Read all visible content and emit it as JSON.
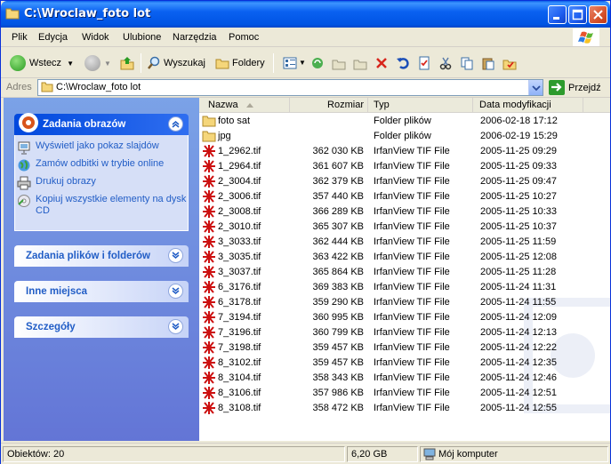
{
  "window": {
    "title": "C:\\Wroclaw_foto lot"
  },
  "menu": [
    "Plik",
    "Edycja",
    "Widok",
    "Ulubione",
    "Narzędzia",
    "Pomoc"
  ],
  "toolbar": {
    "back_label": "Wstecz",
    "search_label": "Wyszukaj",
    "folders_label": "Foldery"
  },
  "address": {
    "label": "Adres",
    "value": "C:\\Wroclaw_foto lot",
    "go_label": "Przejdź"
  },
  "taskpane": {
    "image_tasks": {
      "title": "Zadania obrazów",
      "items": [
        "Wyświetl jako pokaz slajdów",
        "Zamów odbitki w trybie online",
        "Drukuj obrazy",
        "Kopiuj wszystkie elementy na dysk CD"
      ]
    },
    "file_tasks": "Zadania plików i folderów",
    "other_places": "Inne miejsca",
    "details": "Szczegóły"
  },
  "columns": {
    "name": "Nazwa",
    "size": "Rozmiar",
    "type": "Typ",
    "date": "Data modyfikacji"
  },
  "files": [
    {
      "name": "foto sat",
      "size": "",
      "type": "Folder plików",
      "date": "2006-02-18 17:12",
      "kind": "folder"
    },
    {
      "name": "jpg",
      "size": "",
      "type": "Folder plików",
      "date": "2006-02-19 15:29",
      "kind": "folder"
    },
    {
      "name": "1_2962.tif",
      "size": "362 030 KB",
      "type": "IrfanView TIF File",
      "date": "2005-11-25 09:29",
      "kind": "tif"
    },
    {
      "name": "1_2964.tif",
      "size": "361 607 KB",
      "type": "IrfanView TIF File",
      "date": "2005-11-25 09:33",
      "kind": "tif"
    },
    {
      "name": "2_3004.tif",
      "size": "362 379 KB",
      "type": "IrfanView TIF File",
      "date": "2005-11-25 09:47",
      "kind": "tif"
    },
    {
      "name": "2_3006.tif",
      "size": "357 440 KB",
      "type": "IrfanView TIF File",
      "date": "2005-11-25 10:27",
      "kind": "tif"
    },
    {
      "name": "2_3008.tif",
      "size": "366 289 KB",
      "type": "IrfanView TIF File",
      "date": "2005-11-25 10:33",
      "kind": "tif"
    },
    {
      "name": "2_3010.tif",
      "size": "365 307 KB",
      "type": "IrfanView TIF File",
      "date": "2005-11-25 10:37",
      "kind": "tif"
    },
    {
      "name": "3_3033.tif",
      "size": "362 444 KB",
      "type": "IrfanView TIF File",
      "date": "2005-11-25 11:59",
      "kind": "tif"
    },
    {
      "name": "3_3035.tif",
      "size": "363 422 KB",
      "type": "IrfanView TIF File",
      "date": "2005-11-25 12:08",
      "kind": "tif"
    },
    {
      "name": "3_3037.tif",
      "size": "365 864 KB",
      "type": "IrfanView TIF File",
      "date": "2005-11-25 11:28",
      "kind": "tif"
    },
    {
      "name": "6_3176.tif",
      "size": "369 383 KB",
      "type": "IrfanView TIF File",
      "date": "2005-11-24 11:31",
      "kind": "tif"
    },
    {
      "name": "6_3178.tif",
      "size": "359 290 KB",
      "type": "IrfanView TIF File",
      "date": "2005-11-24 11:55",
      "kind": "tif"
    },
    {
      "name": "7_3194.tif",
      "size": "360 995 KB",
      "type": "IrfanView TIF File",
      "date": "2005-11-24 12:09",
      "kind": "tif"
    },
    {
      "name": "7_3196.tif",
      "size": "360 799 KB",
      "type": "IrfanView TIF File",
      "date": "2005-11-24 12:13",
      "kind": "tif"
    },
    {
      "name": "7_3198.tif",
      "size": "359 457 KB",
      "type": "IrfanView TIF File",
      "date": "2005-11-24 12:22",
      "kind": "tif"
    },
    {
      "name": "8_3102.tif",
      "size": "359 457 KB",
      "type": "IrfanView TIF File",
      "date": "2005-11-24 12:35",
      "kind": "tif"
    },
    {
      "name": "8_3104.tif",
      "size": "358 343 KB",
      "type": "IrfanView TIF File",
      "date": "2005-11-24 12:46",
      "kind": "tif"
    },
    {
      "name": "8_3106.tif",
      "size": "357 986 KB",
      "type": "IrfanView TIF File",
      "date": "2005-11-24 12:51",
      "kind": "tif"
    },
    {
      "name": "8_3108.tif",
      "size": "358 472 KB",
      "type": "IrfanView TIF File",
      "date": "2005-11-24 12:55",
      "kind": "tif"
    }
  ],
  "status": {
    "objects": "Obiektów: 20",
    "size": "6,20 GB",
    "location": "Mój komputer"
  },
  "colors": {
    "title_blue": "#0054e3",
    "taskpane_top": "#7ba2e7",
    "link_blue": "#215dc6",
    "folder_yellow": "#f5d67a",
    "tif_red": "#cc1010"
  }
}
